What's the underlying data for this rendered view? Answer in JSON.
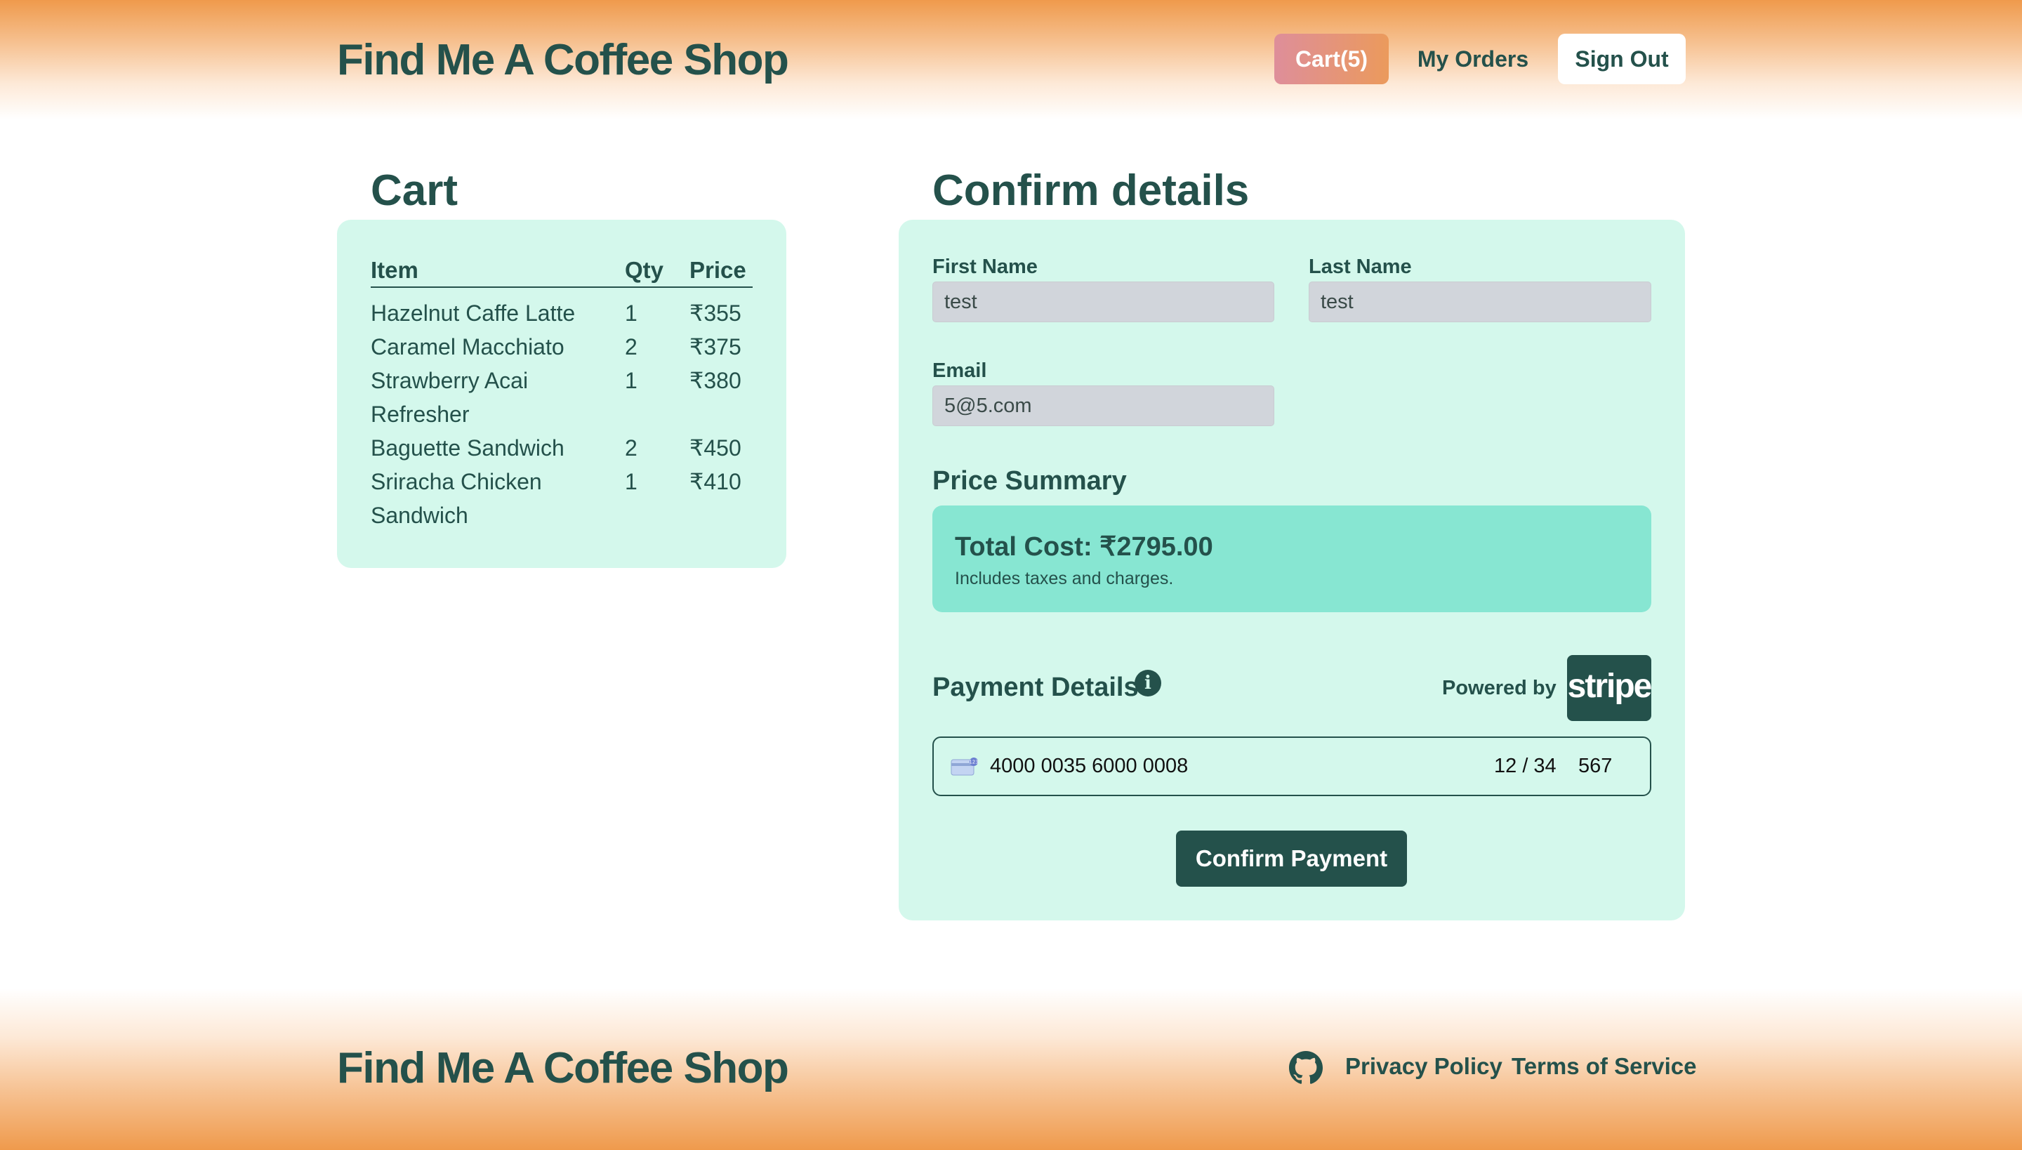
{
  "header": {
    "brand": "Find Me A Coffee Shop",
    "nav": {
      "cart": "Cart(5)",
      "my_orders": "My Orders",
      "sign_out": "Sign Out"
    }
  },
  "cart": {
    "title": "Cart",
    "columns": [
      "Item",
      "Qty",
      "Price"
    ],
    "rows": [
      {
        "item": "Hazelnut Caffe Latte",
        "qty": "1",
        "price": "₹355"
      },
      {
        "item": "Caramel Macchiato",
        "qty": "2",
        "price": "₹375"
      },
      {
        "item": "Strawberry Acai Refresher",
        "qty": "1",
        "price": "₹380"
      },
      {
        "item": "Baguette Sandwich",
        "qty": "2",
        "price": "₹450"
      },
      {
        "item": "Sriracha Chicken Sandwich",
        "qty": "1",
        "price": "₹410"
      }
    ]
  },
  "confirm": {
    "title": "Confirm details",
    "first_name": {
      "label": "First Name",
      "value": "test"
    },
    "last_name": {
      "label": "Last Name",
      "value": "test"
    },
    "email": {
      "label": "Email",
      "value": "5@5.com"
    },
    "price_summary": {
      "title": "Price Summary",
      "total": "Total Cost: ₹2795.00",
      "note": "Includes taxes and charges."
    },
    "payment": {
      "title": "Payment Details",
      "info_icon": "info-icon",
      "powered_by": "Powered by",
      "stripe_logo": "stripe",
      "card_number": "4000 0035 6000 0008",
      "expiry": "12 / 34",
      "cvc": "567",
      "confirm_button": "Confirm Payment"
    }
  },
  "footer": {
    "brand": "Find Me A Coffee Shop",
    "github_icon": "github-icon",
    "privacy": "Privacy Policy",
    "terms": "Terms of Service"
  },
  "colors": {
    "primary": "#24514b",
    "card_bg": "#d4f8ec",
    "summary_bg": "#87e6d2",
    "header_orange": "#ef9a4c",
    "cart_pink": "#de8e9a"
  }
}
